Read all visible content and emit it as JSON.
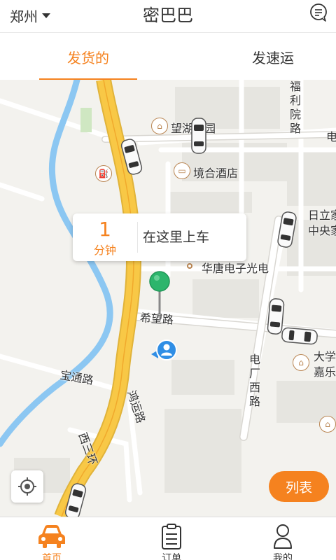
{
  "header": {
    "city": "郑州",
    "title": "密巴巴",
    "message_icon": "message-icon"
  },
  "tabs": [
    {
      "label": "发货的",
      "active": true
    },
    {
      "label": "发速运",
      "active": false
    }
  ],
  "map": {
    "labels": {
      "wanghu": "望湖花园",
      "hotel": "境合酒店",
      "electronics": "华唐电子光电",
      "xiwang_road": "希望路",
      "baotong_road": "宝通路",
      "hongyun_road": "鸿运路",
      "xisanhuan": "西三环",
      "dianchang_road": "电厂西路",
      "fuli_road": "福利院路",
      "rili_center": "日立家",
      "central": "中央家",
      "university": "大学",
      "jiale": "嘉乐",
      "edge_dian": "电",
      "edge_e": "电"
    },
    "callout": {
      "minutes": "1",
      "unit": "分钟",
      "board_text": "在这里上车"
    }
  },
  "buttons": {
    "list": "列表"
  },
  "bottom_nav": [
    {
      "label": "首页",
      "icon": "car-icon",
      "active": true
    },
    {
      "label": "订单",
      "icon": "clipboard-icon",
      "active": false
    },
    {
      "label": "我的",
      "icon": "person-icon",
      "active": false
    }
  ],
  "colors": {
    "accent": "#f5821f",
    "road_main": "#f8c846",
    "river": "#8cc7f2",
    "pin": "#2db56c",
    "user_marker": "#2f8ee5"
  }
}
